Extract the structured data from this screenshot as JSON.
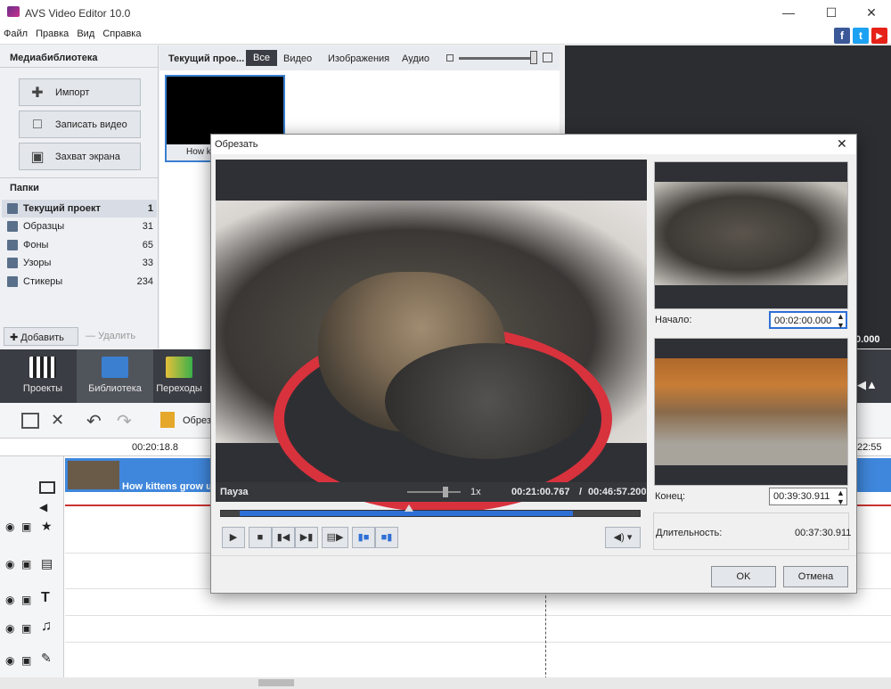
{
  "window": {
    "title": "AVS Video Editor 10.0"
  },
  "menu": [
    "Файл",
    "Правка",
    "Вид",
    "Справка"
  ],
  "social": [
    "f",
    "t",
    "▶"
  ],
  "left_panel": {
    "title": "Медиабиблиотека",
    "buttons": [
      "Импорт",
      "Записать видео",
      "Захват экрана"
    ],
    "folders_title": "Папки",
    "folders": [
      {
        "name": "Текущий проект",
        "count": "1"
      },
      {
        "name": "Образцы",
        "count": "31"
      },
      {
        "name": "Фоны",
        "count": "65"
      },
      {
        "name": "Узоры",
        "count": "33"
      },
      {
        "name": "Стикеры",
        "count": "234"
      }
    ],
    "add_label": "Добавить",
    "delete_label": "Удалить"
  },
  "media_tabs": {
    "project": "Текущий прое...",
    "tabs": [
      "Все",
      "Видео",
      "Изображения",
      "Аудио"
    ],
    "thumb_label": "How k"
  },
  "nav": [
    "Проекты",
    "Библиотека",
    "Переходы"
  ],
  "toolbar": {
    "trim_label": "Обреза"
  },
  "timeline": {
    "time_left": "00:20:18.8",
    "time_right": "22:55",
    "right_time": "0.000",
    "clip_title": "How kittens grow u"
  },
  "dialog": {
    "title": "Обрезать",
    "status": "Пауза",
    "speed": "1x",
    "current_time": "00:21:00.767",
    "separator": "/",
    "total_time": "00:46:57.200",
    "seek_fraction": 0.45,
    "start_label": "Начало:",
    "start_value": "00:02:00.000",
    "end_label": "Конец:",
    "end_value": "00:39:30.911",
    "duration_label": "Длительность:",
    "duration_value": "00:37:30.911",
    "ok_label": "OK",
    "cancel_label": "Отмена"
  }
}
